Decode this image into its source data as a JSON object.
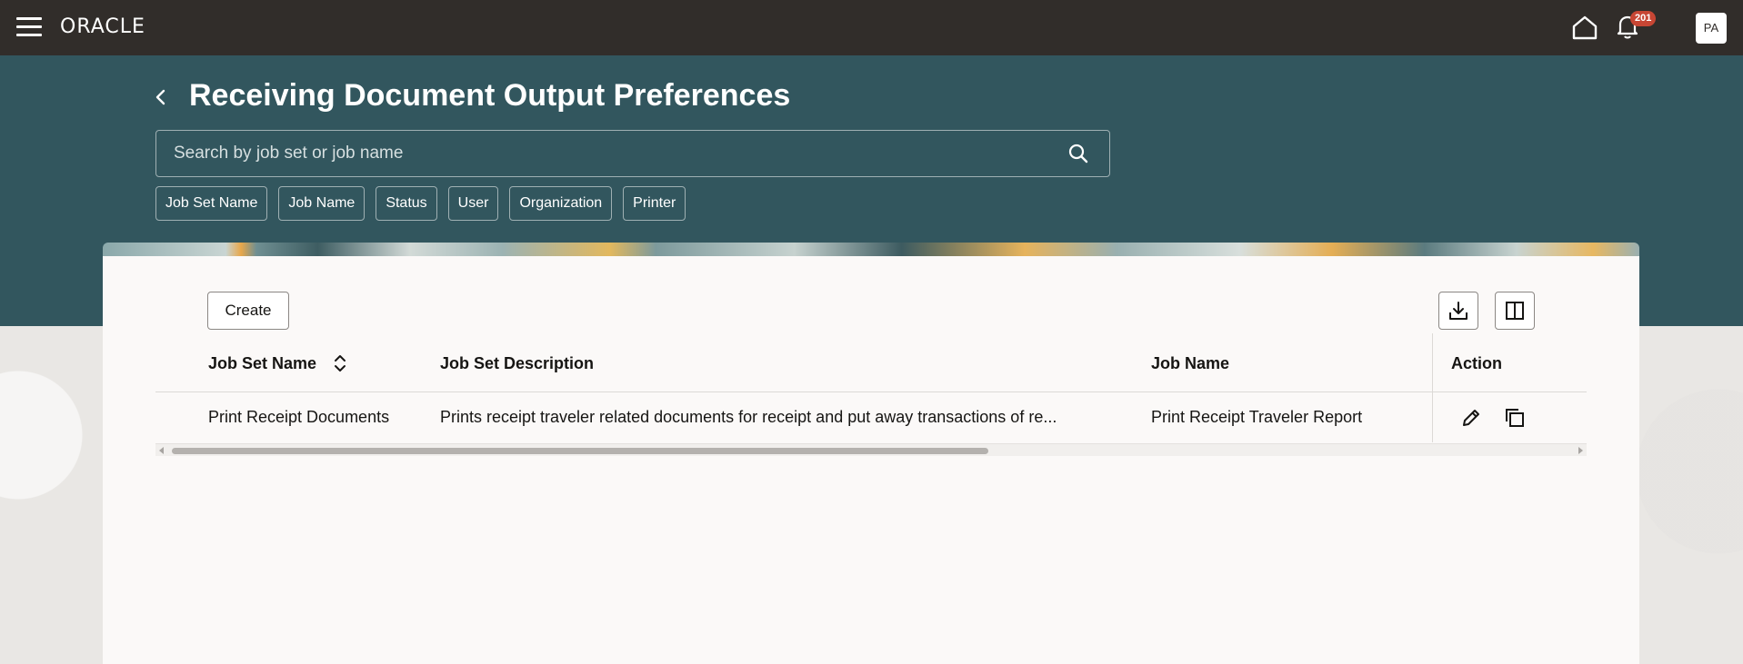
{
  "topbar": {
    "logo": "ORACLE",
    "notification_count": "201",
    "user_initials": "PA"
  },
  "page": {
    "title": "Receiving Document Output Preferences"
  },
  "search": {
    "placeholder": "Search by job set or job name"
  },
  "filters": [
    "Job Set Name",
    "Job Name",
    "Status",
    "User",
    "Organization",
    "Printer"
  ],
  "toolbar": {
    "create_label": "Create"
  },
  "table": {
    "columns": [
      "Job Set Name",
      "Job Set Description",
      "Job Name",
      "Action"
    ],
    "rows": [
      {
        "job_set_name": "Print Receipt Documents",
        "job_set_description": "Prints receipt traveler related documents for receipt and put away transactions of re...",
        "job_name": "Print Receipt Traveler Report"
      }
    ]
  },
  "icons": {
    "menu": "hamburger-icon",
    "home": "home-icon",
    "notifications": "bell-icon",
    "back": "chevron-left-icon",
    "search": "search-icon",
    "sort": "sort-icon",
    "export": "download-icon",
    "columns": "columns-icon",
    "edit": "pencil-icon",
    "duplicate": "copy-icon"
  },
  "colors": {
    "topbar": "#312d2a",
    "header_band": "#32565e",
    "badge": "#c74634",
    "card": "#fbf9f8"
  }
}
